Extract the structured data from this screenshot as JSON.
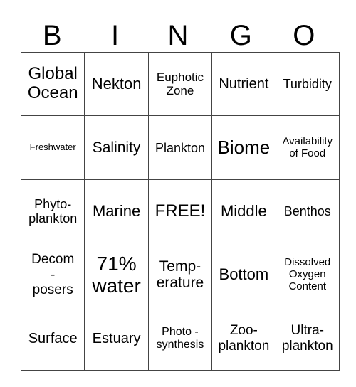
{
  "header": {
    "letters": [
      "B",
      "I",
      "N",
      "G",
      "O"
    ]
  },
  "board": {
    "rows": [
      [
        "Global\nOcean",
        "Nekton",
        "Euphotic\nZone",
        "Nutrient",
        "Turbidity"
      ],
      [
        "Freshwater",
        "Salinity",
        "Plankton",
        "Biome",
        "Availability\nof Food"
      ],
      [
        "Phyto-\nplankton",
        "Marine",
        "FREE!",
        "Middle",
        "Benthos"
      ],
      [
        "Decom\n-\nposers",
        "71%\nwater",
        "Temp-\nerature",
        "Bottom",
        "Dissolved\nOxygen\nContent"
      ],
      [
        "Surface",
        "Estuary",
        "Photo -\nsynthesis",
        "Zoo-\nplankton",
        "Ultra-\nplankton"
      ]
    ]
  }
}
